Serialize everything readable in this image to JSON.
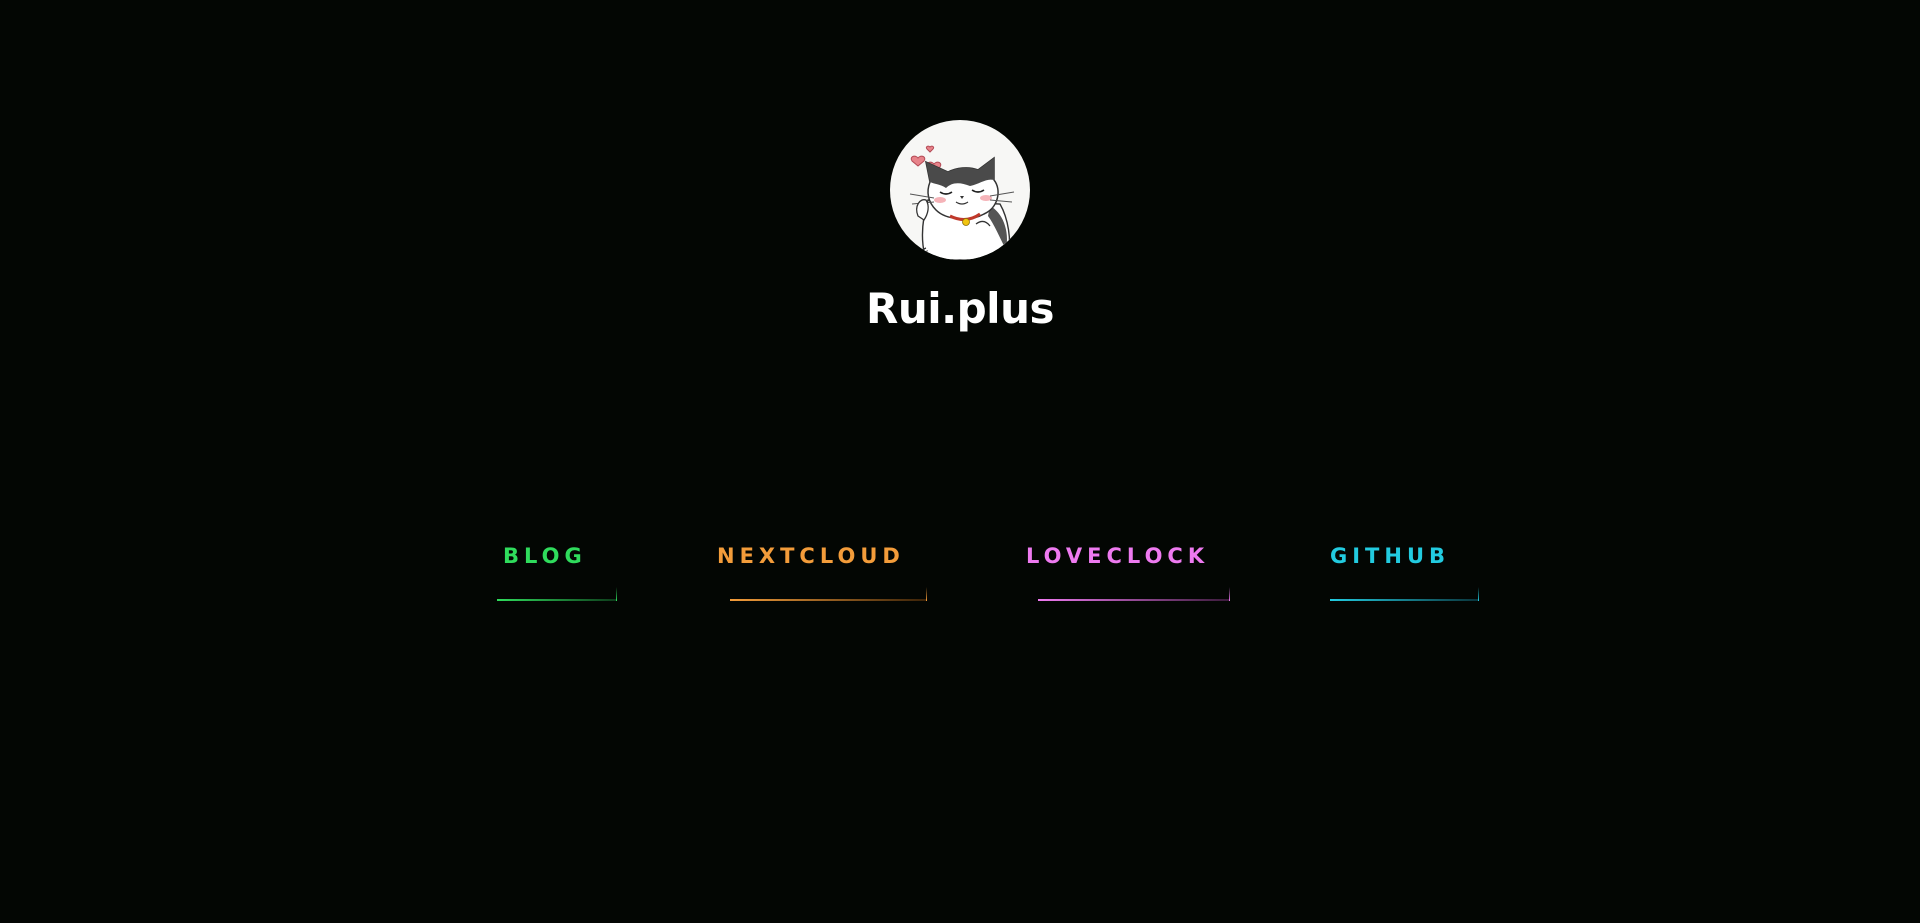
{
  "site": {
    "title": "Rui.plus"
  },
  "nav": [
    {
      "label": "BLOG",
      "color": "#2fdc5c"
    },
    {
      "label": "NEXTCLOUD",
      "color": "#f39c3a"
    },
    {
      "label": "LOVECLOCK",
      "color": "#ee7af0"
    },
    {
      "label": "GITHUB",
      "color": "#22cbe0"
    }
  ],
  "colors": {
    "background": "#030603",
    "title": "#ffffff"
  },
  "icons": {
    "avatar": "cat-with-hearts-icon"
  }
}
